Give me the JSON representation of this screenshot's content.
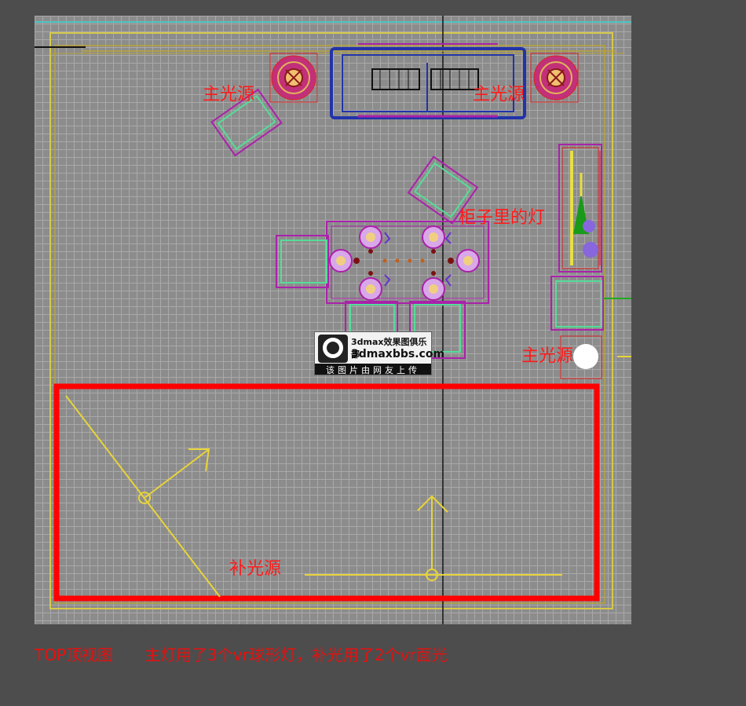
{
  "viewport": {
    "labels": {
      "main_light_left": "主光源",
      "main_light_right": "主光源",
      "main_light_bottom_right": "主光源",
      "cabinet_light": "柜子里的灯",
      "fill_light": "补光源"
    },
    "watermark": {
      "line1": "3dmax效果图俱乐部",
      "line2": "3dmaxbbs.com",
      "line3": "该图片由网友上传"
    }
  },
  "caption": {
    "view_name": "TOP顶视图",
    "description": "主灯用了3个vr球形灯，补光用了2个vr面光"
  },
  "colors": {
    "viewport_bg": "#8c8c8c",
    "label_red": "#ff1a1a",
    "light_yellow": "#e8d43a",
    "area_light_red": "#ff0000",
    "sofa_blue": "#2233aa",
    "furniture_purple": "#aa22aa",
    "chair_green": "#55dd99"
  }
}
